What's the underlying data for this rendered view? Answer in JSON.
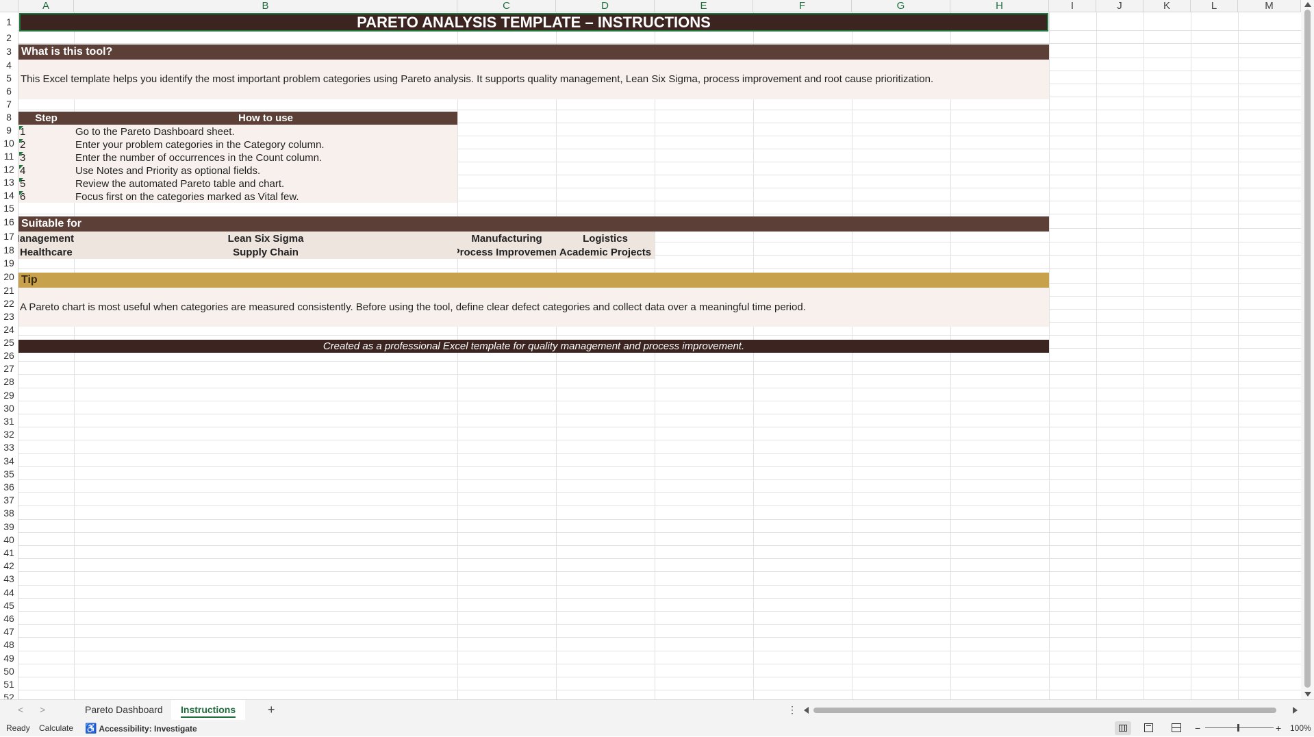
{
  "columns": [
    "A",
    "B",
    "C",
    "D",
    "E",
    "F",
    "G",
    "H",
    "I",
    "J",
    "K",
    "L",
    "M"
  ],
  "rows": [
    "1",
    "2",
    "3",
    "4",
    "5",
    "6",
    "7",
    "8",
    "9",
    "10",
    "11",
    "12",
    "13",
    "14",
    "15",
    "16",
    "17",
    "18",
    "19",
    "20",
    "21",
    "22",
    "23",
    "24",
    "25",
    "26",
    "27",
    "28",
    "29",
    "30",
    "31",
    "32",
    "33",
    "34",
    "35",
    "36",
    "37",
    "38",
    "39",
    "40",
    "41",
    "42",
    "43",
    "44",
    "45",
    "46",
    "47",
    "48",
    "49",
    "50",
    "51",
    "52"
  ],
  "colors": {
    "title_bg": "#3c2420",
    "section_bg": "#5c3f37",
    "light_bg": "#f7f0ec",
    "tag_bg": "#efe5df",
    "tip_bg": "#c8a14c",
    "footer_bg": "#3c2420",
    "accent": "#1e6b3c"
  },
  "sheet": {
    "title": "PARETO ANALYSIS TEMPLATE – INSTRUCTIONS",
    "what_header": "What is this tool?",
    "what_text": "This Excel template helps you identify the most important problem categories using Pareto analysis. It supports quality management, Lean Six Sigma, process improvement and root cause prioritization.",
    "steps_header": {
      "step": "Step",
      "how": "How to use"
    },
    "steps": [
      {
        "n": "1",
        "text": "Go to the Pareto Dashboard sheet."
      },
      {
        "n": "2",
        "text": "Enter your problem categories in the Category column."
      },
      {
        "n": "3",
        "text": "Enter the number of occurrences in the Count column."
      },
      {
        "n": "4",
        "text": "Use Notes and Priority as optional fields."
      },
      {
        "n": "5",
        "text": "Review the automated Pareto table and chart."
      },
      {
        "n": "6",
        "text": "Focus first on the categories marked as Vital few."
      }
    ],
    "suitable_header": "Suitable for",
    "suitable_row1": [
      "Quality Management",
      "Lean Six Sigma",
      "Manufacturing",
      "Logistics"
    ],
    "suitable_row2": [
      "Healthcare",
      "Supply Chain",
      "Process Improvement",
      "Academic Projects"
    ],
    "tip_header": "Tip",
    "tip_text": "A Pareto chart is most useful when categories are measured consistently. Before using the tool, define clear defect categories and collect data over a meaningful time period.",
    "footer": "Created as a professional Excel template for quality management and process improvement."
  },
  "tabs": {
    "sheet1": "Pareto Dashboard",
    "sheet2": "Instructions",
    "add": "+",
    "prev": "<",
    "next": ">",
    "more": "⋮"
  },
  "status": {
    "ready": "Ready",
    "calculate": "Calculate",
    "accessibility": "Accessibility: Investigate",
    "zoom": "100%",
    "zoom_minus": "−",
    "zoom_plus": "+"
  },
  "icons": {
    "accessibility": "accessibility-icon",
    "normal_view": "normal-view-icon",
    "page_layout": "page-layout-icon",
    "page_break": "page-break-preview-icon"
  }
}
